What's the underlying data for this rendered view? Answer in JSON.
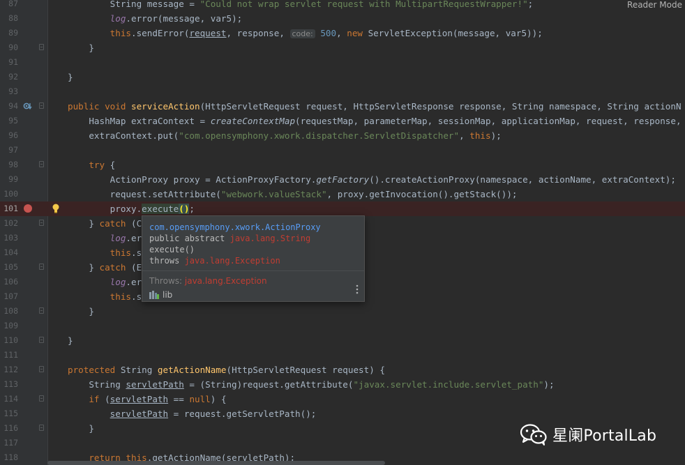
{
  "reader_mode": "Reader Mode",
  "lines": [
    {
      "n": "87",
      "bp": false,
      "fold": false,
      "gi": "",
      "segs": [
        {
          "t": "        String message = ",
          "c": ""
        },
        {
          "t": "\"Could not wrap servlet request with MultipartRequestWrapper!\"",
          "c": "str"
        },
        {
          "t": ";",
          "c": ""
        }
      ]
    },
    {
      "n": "88",
      "bp": false,
      "fold": false,
      "gi": "",
      "segs": [
        {
          "t": "        ",
          "c": ""
        },
        {
          "t": "log",
          "c": "fld"
        },
        {
          "t": ".error(message, var5);",
          "c": ""
        }
      ]
    },
    {
      "n": "89",
      "bp": false,
      "fold": false,
      "gi": "",
      "segs": [
        {
          "t": "        ",
          "c": ""
        },
        {
          "t": "this",
          "c": "kw"
        },
        {
          "t": ".sendError(",
          "c": ""
        },
        {
          "t": "request",
          "c": "ul"
        },
        {
          "t": ", response, ",
          "c": ""
        },
        {
          "t": "code:",
          "c": "hint"
        },
        {
          "t": " 500",
          "c": "num"
        },
        {
          "t": ", ",
          "c": ""
        },
        {
          "t": "new",
          "c": "kw"
        },
        {
          "t": " ServletException(message, var5));",
          "c": ""
        }
      ]
    },
    {
      "n": "90",
      "bp": false,
      "fold": true,
      "gi": "",
      "segs": [
        {
          "t": "    }",
          "c": ""
        }
      ]
    },
    {
      "n": "91",
      "bp": false,
      "fold": false,
      "gi": "",
      "segs": []
    },
    {
      "n": "92",
      "bp": false,
      "fold": false,
      "gi": "",
      "segs": [
        {
          "t": "}",
          "c": ""
        }
      ]
    },
    {
      "n": "93",
      "bp": false,
      "fold": false,
      "gi": "",
      "segs": []
    },
    {
      "n": "94",
      "bp": false,
      "fold": true,
      "gi": "override",
      "segs": [
        {
          "t": "public void ",
          "c": "kw"
        },
        {
          "t": "serviceAction",
          "c": "fn"
        },
        {
          "t": "(HttpServletRequest request, HttpServletResponse response, String namespace, String actionN",
          "c": ""
        }
      ]
    },
    {
      "n": "95",
      "bp": false,
      "fold": false,
      "gi": "",
      "segs": [
        {
          "t": "    HashMap extraContext = ",
          "c": ""
        },
        {
          "t": "createContextMap",
          "c": "it"
        },
        {
          "t": "(requestMap, parameterMap, sessionMap, applicationMap, request, response,",
          "c": ""
        }
      ]
    },
    {
      "n": "96",
      "bp": false,
      "fold": false,
      "gi": "",
      "segs": [
        {
          "t": "    extraContext.put(",
          "c": ""
        },
        {
          "t": "\"com.opensymphony.xwork.dispatcher.ServletDispatcher\"",
          "c": "str"
        },
        {
          "t": ", ",
          "c": ""
        },
        {
          "t": "this",
          "c": "kw"
        },
        {
          "t": ");",
          "c": ""
        }
      ]
    },
    {
      "n": "97",
      "bp": false,
      "fold": false,
      "gi": "",
      "segs": []
    },
    {
      "n": "98",
      "bp": false,
      "fold": true,
      "gi": "",
      "segs": [
        {
          "t": "    ",
          "c": ""
        },
        {
          "t": "try",
          "c": "kw"
        },
        {
          "t": " {",
          "c": ""
        }
      ]
    },
    {
      "n": "99",
      "bp": false,
      "fold": false,
      "gi": "",
      "segs": [
        {
          "t": "        ActionProxy proxy = ActionProxyFactory.",
          "c": ""
        },
        {
          "t": "getFactory",
          "c": "it"
        },
        {
          "t": "().createActionProxy(namespace, actionName, extraContext);",
          "c": ""
        }
      ]
    },
    {
      "n": "100",
      "bp": false,
      "fold": false,
      "gi": "",
      "segs": [
        {
          "t": "        request.setAttribute(",
          "c": ""
        },
        {
          "t": "\"webwork.valueStack\"",
          "c": "str"
        },
        {
          "t": ", proxy.getInvocation().getStack());",
          "c": ""
        }
      ]
    },
    {
      "n": "101",
      "bp": true,
      "fold": false,
      "gi": "bulb",
      "segs": [
        {
          "t": "        proxy.",
          "c": ""
        },
        {
          "t": "execute",
          "c": "hl-word"
        },
        {
          "t": "()",
          "c": "caret-hl"
        },
        {
          "t": ";",
          "c": ""
        }
      ]
    },
    {
      "n": "102",
      "bp": false,
      "fold": true,
      "gi": "",
      "segs": [
        {
          "t": "    } ",
          "c": ""
        },
        {
          "t": "catch",
          "c": "kw"
        },
        {
          "t": " (C",
          "c": ""
        }
      ]
    },
    {
      "n": "103",
      "bp": false,
      "fold": false,
      "gi": "",
      "segs": [
        {
          "t": "        ",
          "c": ""
        },
        {
          "t": "log",
          "c": "fld"
        },
        {
          "t": ".er",
          "c": ""
        }
      ]
    },
    {
      "n": "104",
      "bp": false,
      "fold": false,
      "gi": "",
      "segs": [
        {
          "t": "        ",
          "c": ""
        },
        {
          "t": "this",
          "c": "kw"
        },
        {
          "t": ".s                                 11);",
          "c": ""
        }
      ]
    },
    {
      "n": "105",
      "bp": false,
      "fold": true,
      "gi": "",
      "segs": [
        {
          "t": "    } ",
          "c": ""
        },
        {
          "t": "catch",
          "c": "kw"
        },
        {
          "t": " (E",
          "c": ""
        }
      ]
    },
    {
      "n": "106",
      "bp": false,
      "fold": false,
      "gi": "",
      "segs": [
        {
          "t": "        ",
          "c": ""
        },
        {
          "t": "log",
          "c": "fld"
        },
        {
          "t": ".er",
          "c": ""
        }
      ]
    },
    {
      "n": "107",
      "bp": false,
      "fold": false,
      "gi": "",
      "segs": [
        {
          "t": "        ",
          "c": ""
        },
        {
          "t": "this",
          "c": "kw"
        },
        {
          "t": ".s                                 12);",
          "c": ""
        }
      ]
    },
    {
      "n": "108",
      "bp": false,
      "fold": true,
      "gi": "",
      "segs": [
        {
          "t": "    }",
          "c": ""
        }
      ]
    },
    {
      "n": "109",
      "bp": false,
      "fold": false,
      "gi": "",
      "segs": []
    },
    {
      "n": "110",
      "bp": false,
      "fold": true,
      "gi": "",
      "segs": [
        {
          "t": "}",
          "c": ""
        }
      ]
    },
    {
      "n": "111",
      "bp": false,
      "fold": false,
      "gi": "",
      "segs": []
    },
    {
      "n": "112",
      "bp": false,
      "fold": true,
      "gi": "",
      "segs": [
        {
          "t": "protected ",
          "c": "kw"
        },
        {
          "t": "String ",
          "c": ""
        },
        {
          "t": "getActionName",
          "c": "fn"
        },
        {
          "t": "(HttpServletRequest request) {",
          "c": ""
        }
      ]
    },
    {
      "n": "113",
      "bp": false,
      "fold": false,
      "gi": "",
      "segs": [
        {
          "t": "    String ",
          "c": ""
        },
        {
          "t": "servletPath",
          "c": "ul"
        },
        {
          "t": " = (String)request.getAttribute(",
          "c": ""
        },
        {
          "t": "\"javax.servlet.include.servlet_path\"",
          "c": "str"
        },
        {
          "t": ");",
          "c": ""
        }
      ]
    },
    {
      "n": "114",
      "bp": false,
      "fold": true,
      "gi": "",
      "segs": [
        {
          "t": "    ",
          "c": ""
        },
        {
          "t": "if",
          "c": "kw"
        },
        {
          "t": " (",
          "c": ""
        },
        {
          "t": "servletPath",
          "c": "ul"
        },
        {
          "t": " == ",
          "c": ""
        },
        {
          "t": "null",
          "c": "kw"
        },
        {
          "t": ") {",
          "c": ""
        }
      ]
    },
    {
      "n": "115",
      "bp": false,
      "fold": false,
      "gi": "",
      "segs": [
        {
          "t": "        ",
          "c": ""
        },
        {
          "t": "servletPath",
          "c": "ul"
        },
        {
          "t": " = request.getServletPath();",
          "c": ""
        }
      ]
    },
    {
      "n": "116",
      "bp": false,
      "fold": true,
      "gi": "",
      "segs": [
        {
          "t": "    }",
          "c": ""
        }
      ]
    },
    {
      "n": "117",
      "bp": false,
      "fold": false,
      "gi": "",
      "segs": []
    },
    {
      "n": "118",
      "bp": false,
      "fold": false,
      "gi": "",
      "segs": [
        {
          "t": "    ",
          "c": ""
        },
        {
          "t": "return ",
          "c": "kw"
        },
        {
          "t": "this",
          "c": "kw"
        },
        {
          "t": ".getActionName(",
          "c": ""
        },
        {
          "t": "servletPath",
          "c": "ul"
        },
        {
          "t": ");",
          "c": ""
        }
      ]
    }
  ],
  "popup": {
    "package": "com.opensymphony.xwork.ActionProxy",
    "modifiers": "public abstract ",
    "return_type": "java.lang.String",
    "method": " execute()",
    "throws_kw": "throws ",
    "throws_type": "java.lang.Exception",
    "throws_label": "Throws: ",
    "throws_value": "java.lang.Exception",
    "lib_label": "lib"
  },
  "watermark": {
    "text": "星阑PortalLab"
  },
  "colors": {
    "breakpoint": "#c75450",
    "keyword": "#cc7832",
    "string": "#6a8759",
    "method": "#ffc66d",
    "field": "#9876aa",
    "link": "#589df6",
    "exception": "#c13d32"
  }
}
